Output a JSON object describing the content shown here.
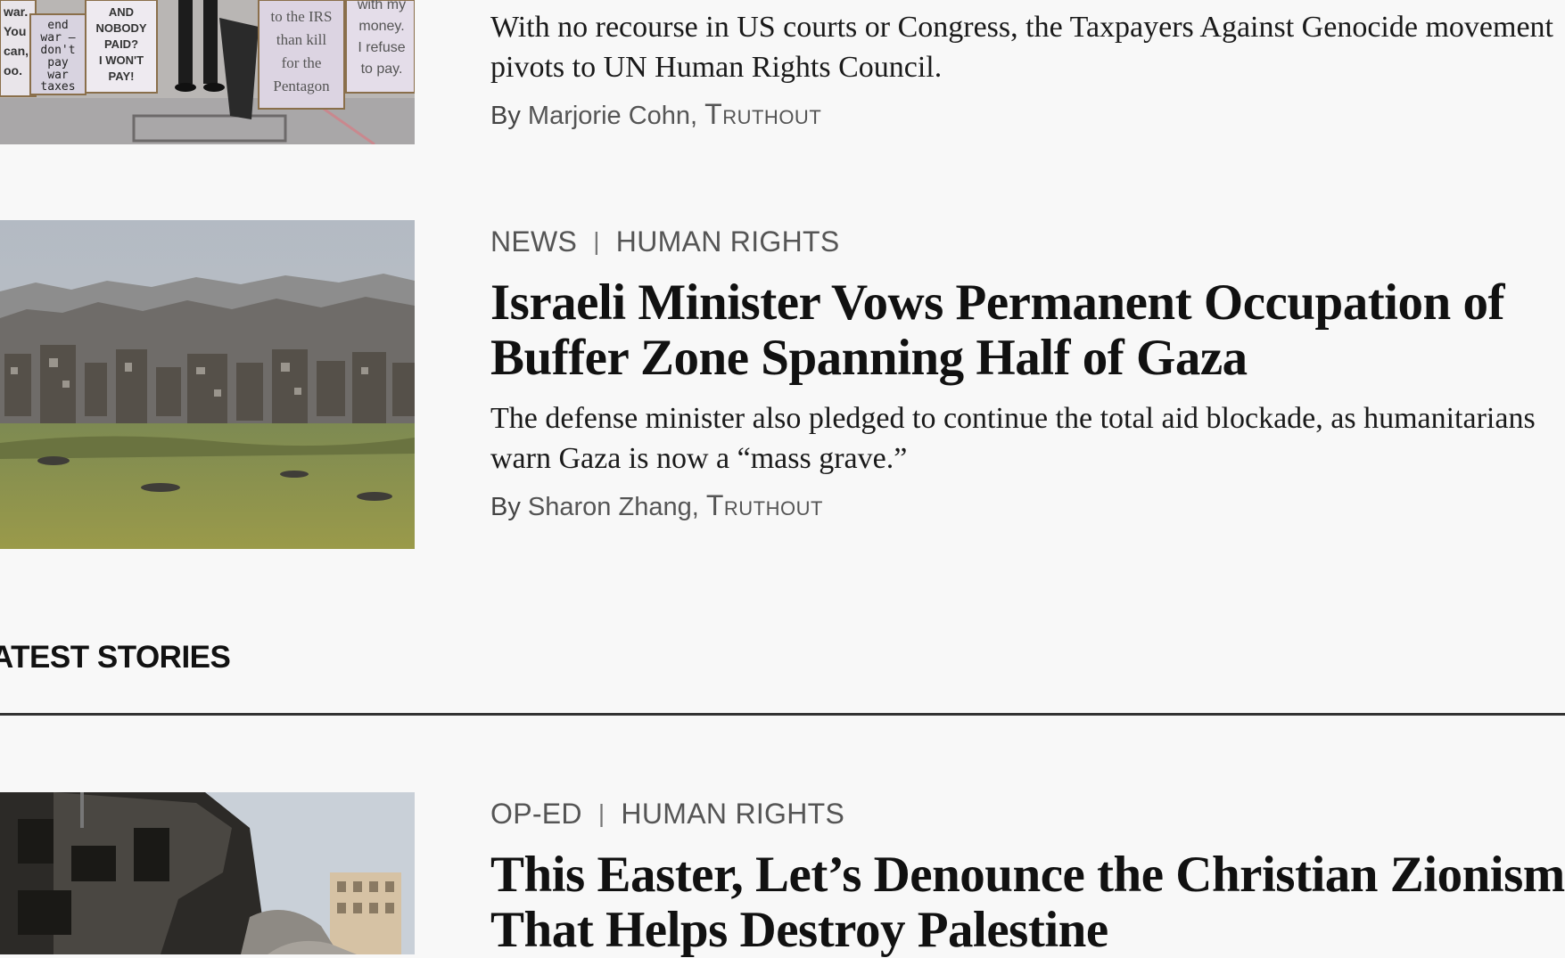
{
  "articles": [
    {
      "dek": "With no recourse in US courts or Congress, the Taxpayers Against Genocide movement pivots to UN Human Rights Council.",
      "dek_line1": "With no recourse in US courts or Congress, the Taxpayers Against Genocide movement",
      "dek_line2": "pivots to UN Human Rights Council.",
      "byline_prefix": "By",
      "author": "Marjorie Cohn",
      "publication": "Truthout",
      "thumb_signs": [
        [
          "war.",
          "You",
          "can,",
          "oo."
        ],
        [
          "end",
          "war –",
          "don't",
          "pay",
          "war",
          "taxes"
        ],
        [
          "AND",
          "NOBODY",
          "PAID?",
          "I WON'T",
          "PAY!"
        ],
        [
          "to the IRS",
          "than kill",
          "for the",
          "Pentagon"
        ],
        [
          "with my",
          "money.",
          "I refuse",
          "to pay."
        ]
      ]
    },
    {
      "category": "NEWS",
      "tag": "HUMAN RIGHTS",
      "title": "Israeli Minister Vows Permanent Occupation of Buffer Zone Spanning Half of Gaza",
      "title_line1": "Israeli Minister Vows Permanent Occupation of",
      "title_line2": "Buffer Zone Spanning Half of Gaza",
      "dek": "The defense minister also pledged to continue the total aid blockade, as humanitarians warn Gaza is now a “mass grave.”",
      "dek_line1": "The defense minister also pledged to continue the total aid blockade, as humanitarians",
      "dek_line2": "warn Gaza is now a “mass grave.”",
      "byline_prefix": "By",
      "author": "Sharon Zhang",
      "publication": "Truthout"
    },
    {
      "category": "OP-ED",
      "tag": "HUMAN RIGHTS",
      "title": "This Easter, Let’s Denounce the Christian Zionism That Helps Destroy Palestine",
      "title_line1": "This Easter, Let’s Denounce the Christian Zionism",
      "title_line2": "That Helps Destroy Palestine"
    }
  ],
  "section": {
    "heading": "ATEST STORIES"
  },
  "colors": {
    "background": "#f8f8f8",
    "headline": "#111111",
    "meta": "#555555",
    "rule": "#333333"
  }
}
